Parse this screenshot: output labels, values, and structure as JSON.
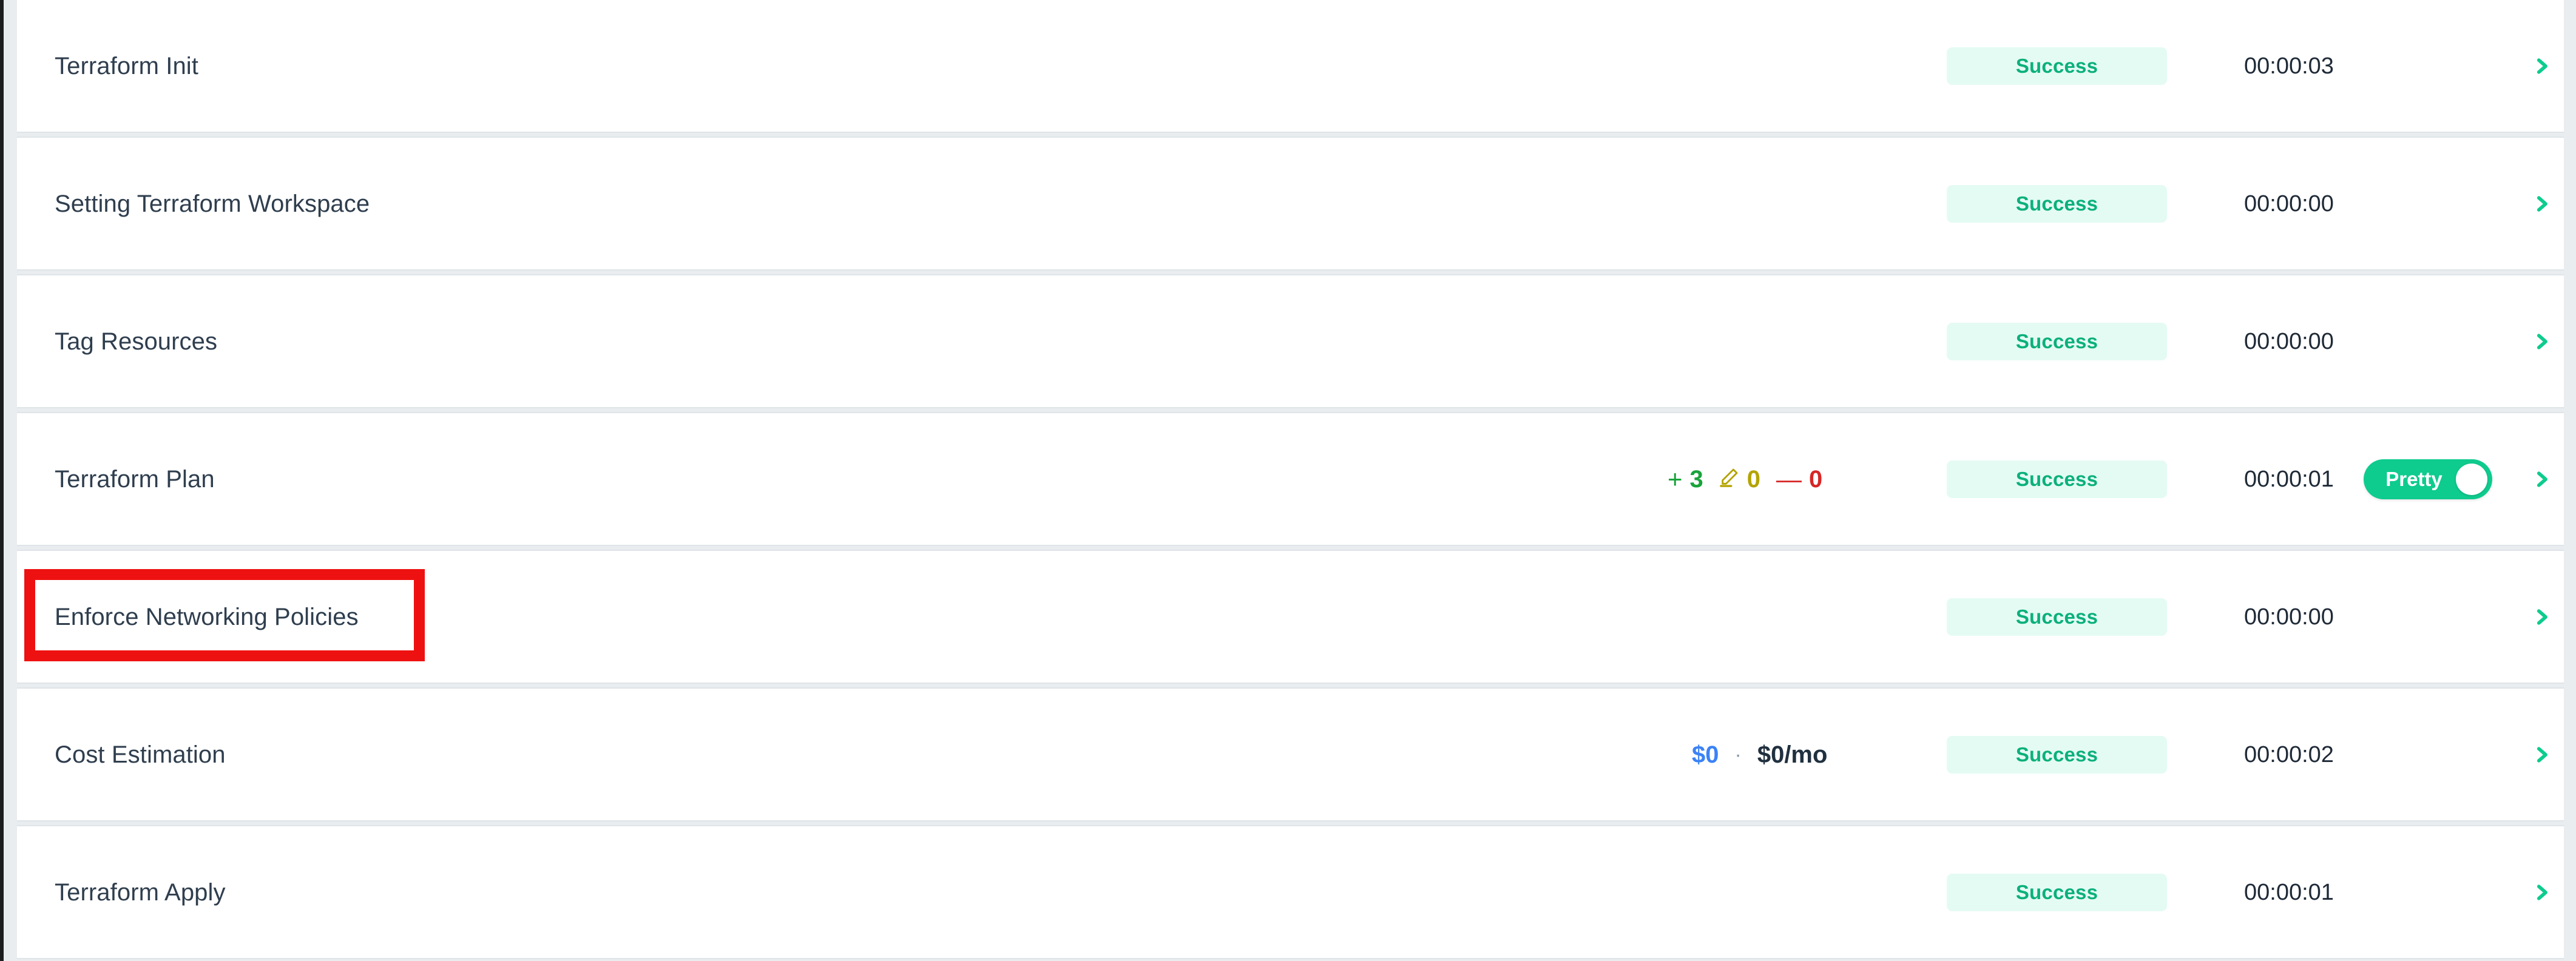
{
  "colors": {
    "accent_green": "#0ecb8e",
    "badge_bg": "#e4fbf3",
    "badge_text": "#0bb07b",
    "title_text": "#2f3e4e",
    "highlight_red": "#ee1111",
    "count_add": "#19a33b",
    "count_change": "#b3a400",
    "count_delete": "#d72626",
    "cost_now": "#3b82f6",
    "page_bg": "#e9edf0"
  },
  "steps": [
    {
      "name": "Terraform Init",
      "status": "Success",
      "duration": "00:00:03",
      "chevron_icon": "chevron-right-icon",
      "has_plan_counts": false,
      "has_cost": false,
      "has_toggle": false,
      "highlighted": false
    },
    {
      "name": "Setting Terraform Workspace",
      "status": "Success",
      "duration": "00:00:00",
      "chevron_icon": "chevron-right-icon",
      "has_plan_counts": false,
      "has_cost": false,
      "has_toggle": false,
      "highlighted": false
    },
    {
      "name": "Tag Resources",
      "status": "Success",
      "duration": "00:00:00",
      "chevron_icon": "chevron-right-icon",
      "has_plan_counts": false,
      "has_cost": false,
      "has_toggle": false,
      "highlighted": false
    },
    {
      "name": "Terraform Plan",
      "status": "Success",
      "duration": "00:00:01",
      "chevron_icon": "chevron-right-icon",
      "has_plan_counts": true,
      "has_cost": false,
      "has_toggle": true,
      "highlighted": false,
      "plan_counts": {
        "add_glyph": "+",
        "add": "3",
        "change_icon": "pencil-icon",
        "change": "0",
        "delete_glyph": "—",
        "delete": "0"
      },
      "toggle": {
        "label": "Pretty",
        "state": "on"
      }
    },
    {
      "name": "Enforce Networking Policies",
      "status": "Success",
      "duration": "00:00:00",
      "chevron_icon": "chevron-right-icon",
      "has_plan_counts": false,
      "has_cost": false,
      "has_toggle": false,
      "highlighted": true
    },
    {
      "name": "Cost Estimation",
      "status": "Success",
      "duration": "00:00:02",
      "chevron_icon": "chevron-right-icon",
      "has_plan_counts": false,
      "has_cost": true,
      "has_toggle": false,
      "highlighted": false,
      "cost": {
        "current": "$0",
        "separator": "·",
        "monthly": "$0/mo"
      }
    },
    {
      "name": "Terraform Apply",
      "status": "Success",
      "duration": "00:00:01",
      "chevron_icon": "chevron-right-icon",
      "has_plan_counts": false,
      "has_cost": false,
      "has_toggle": false,
      "highlighted": false
    }
  ]
}
